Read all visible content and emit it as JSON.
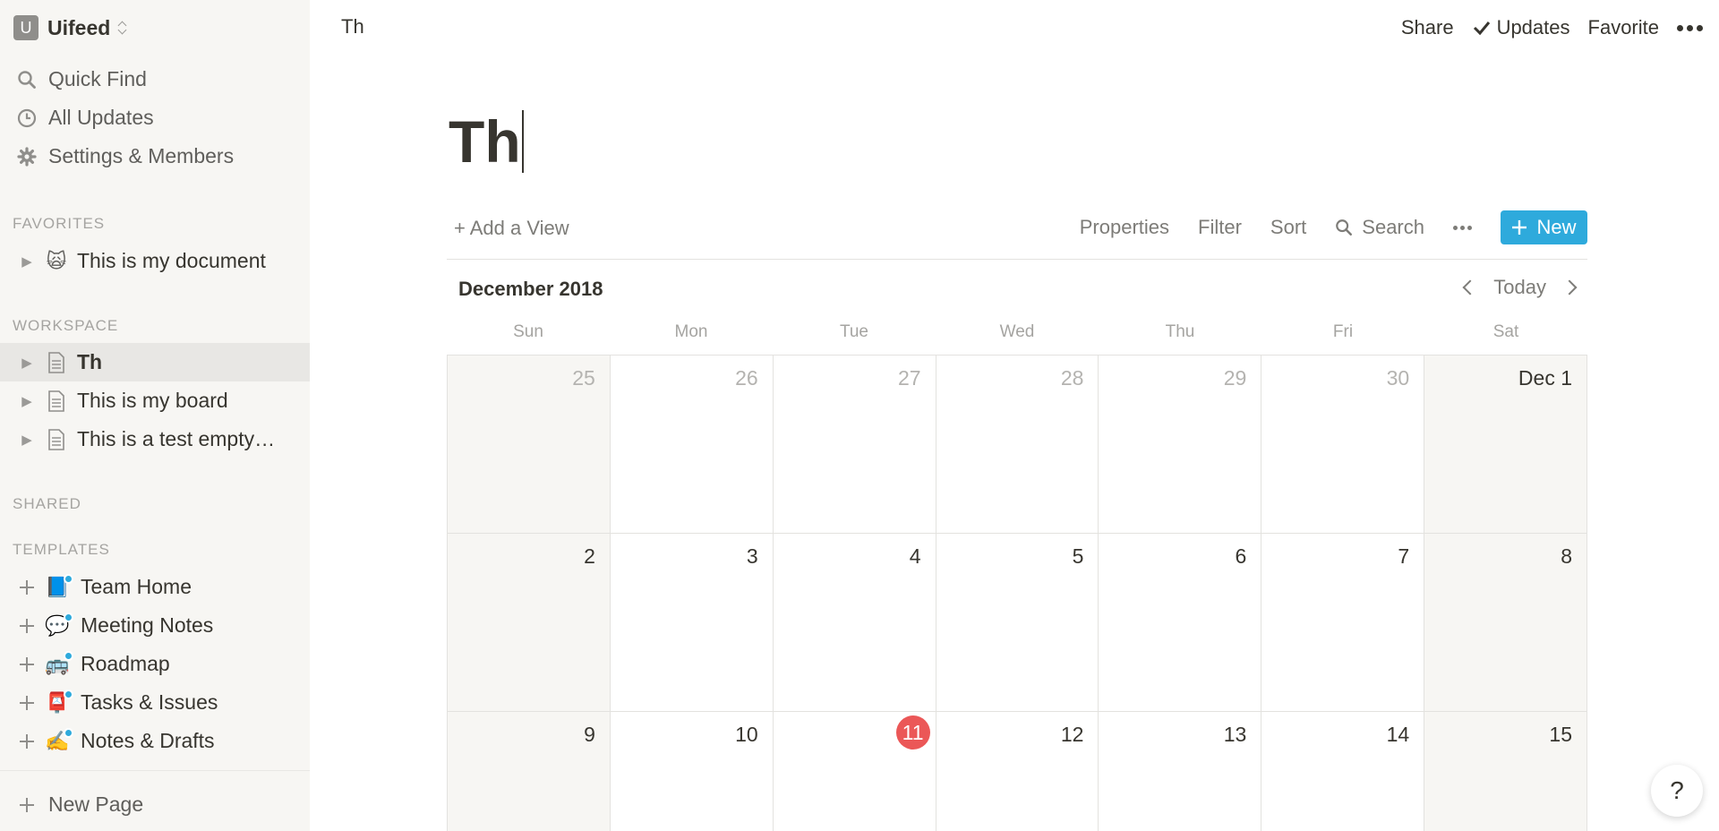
{
  "sidebar": {
    "workspace": {
      "avatar": "U",
      "name": "Uifeed"
    },
    "nav": [
      {
        "label": "Quick Find",
        "icon": "search-icon"
      },
      {
        "label": "All Updates",
        "icon": "clock-icon"
      },
      {
        "label": "Settings & Members",
        "icon": "gear-icon"
      }
    ],
    "favorites_title": "FAVORITES",
    "favorites": [
      {
        "emoji": "🙀",
        "label": "This is my document"
      }
    ],
    "workspace_title": "WORKSPACE",
    "workspace_pages": [
      {
        "label": "Th",
        "active": true
      },
      {
        "label": "This is my board",
        "active": false
      },
      {
        "label": "This is a test empty…",
        "active": false
      }
    ],
    "shared_title": "SHARED",
    "templates_title": "TEMPLATES",
    "templates": [
      {
        "emoji": "📘",
        "label": "Team Home"
      },
      {
        "emoji": "💬",
        "label": "Meeting Notes"
      },
      {
        "emoji": "🚌",
        "label": "Roadmap"
      },
      {
        "emoji": "📮",
        "label": "Tasks & Issues"
      },
      {
        "emoji": "✍️",
        "label": "Notes & Drafts"
      }
    ],
    "new_page": "New Page"
  },
  "topbar": {
    "breadcrumb": "Th",
    "share": "Share",
    "updates": "Updates",
    "favorite": "Favorite"
  },
  "page": {
    "title": "Th"
  },
  "toolbar": {
    "add_view": "+ Add a View",
    "properties": "Properties",
    "filter": "Filter",
    "sort": "Sort",
    "search": "Search",
    "new": "New"
  },
  "calendar": {
    "month": "December 2018",
    "today": "Today",
    "weekdays": [
      "Sun",
      "Mon",
      "Tue",
      "Wed",
      "Thu",
      "Fri",
      "Sat"
    ],
    "weeks": [
      [
        "25",
        "26",
        "27",
        "28",
        "29",
        "30",
        "Dec 1"
      ],
      [
        "2",
        "3",
        "4",
        "5",
        "6",
        "7",
        "8"
      ],
      [
        "9",
        "10",
        "11",
        "12",
        "13",
        "14",
        "15"
      ]
    ],
    "today_date": "11"
  },
  "help": "?",
  "colors": {
    "accent": "#2eaadc",
    "today": "#eb5757",
    "sidebar_bg": "#f7f6f3"
  }
}
